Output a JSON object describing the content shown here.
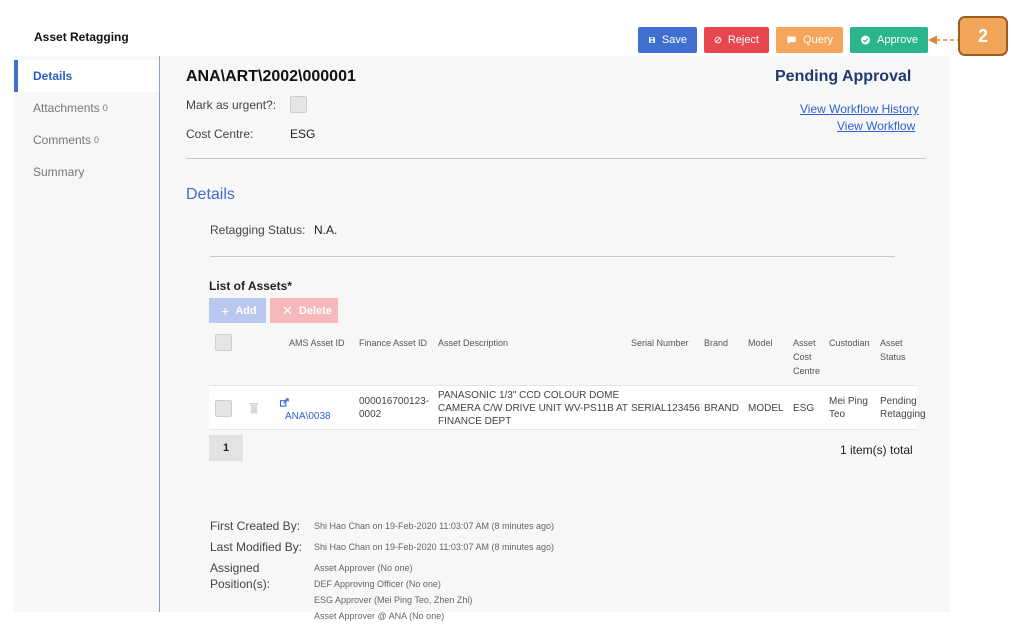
{
  "app": {
    "title": "Asset Retagging"
  },
  "toolbar": {
    "save_label": "Save",
    "reject_label": "Reject",
    "query_label": "Query",
    "approve_label": "Approve"
  },
  "callout": {
    "number": "2"
  },
  "sidebar": {
    "items": [
      {
        "label": "Details",
        "count": ""
      },
      {
        "label": "Attachments",
        "count": "0"
      },
      {
        "label": "Comments",
        "count": "0"
      },
      {
        "label": "Summary",
        "count": ""
      }
    ]
  },
  "header": {
    "doc_number": "ANA\\ART\\2002\\000001",
    "status": "Pending Approval",
    "workflow_history_link": "View Workflow History",
    "workflow_link": "View Workflow"
  },
  "form": {
    "urgent_label": "Mark as urgent?:",
    "cost_centre_label": "Cost Centre:",
    "cost_centre_value": "ESG"
  },
  "details": {
    "title": "Details",
    "retag_status_label": "Retagging Status:",
    "retag_status_value": "N.A."
  },
  "assets": {
    "title": "List of Assets*",
    "add_label": "Add",
    "delete_label": "Delete",
    "columns": {
      "ams_id": "AMS Asset ID",
      "finance_id": "Finance Asset ID",
      "description": "Asset Description",
      "serial": "Serial Number",
      "brand": "Brand",
      "model": "Model",
      "cost_centre_1": "Asset",
      "cost_centre_2": "Cost",
      "cost_centre_3": "Centre",
      "custodian": "Custodian",
      "status_1": "Asset",
      "status_2": "Status"
    },
    "rows": [
      {
        "ams_id": "ANA\\0038",
        "finance_id_1": "000016700123-",
        "finance_id_2": "0002",
        "description_1": "PANASONIC 1/3\" CCD COLOUR DOME",
        "description_2": "CAMERA C/W DRIVE UNIT WV-PS11B AT",
        "description_3": "FINANCE DEPT",
        "serial": "SERIAL123456",
        "brand": "BRAND",
        "model": "MODEL",
        "cost_centre": "ESG",
        "custodian_1": "Mei Ping",
        "custodian_2": "Teo",
        "status_1": "Pending",
        "status_2": "Retagging"
      }
    ],
    "page": "1",
    "total": "1 item(s) total"
  },
  "meta": {
    "first_created_label": "First Created By:",
    "first_created_value": "Shi Hao Chan on 19-Feb-2020 11:03:07 AM (8 minutes ago)",
    "last_modified_label": "Last Modified By:",
    "last_modified_value": "Shi Hao Chan on 19-Feb-2020 11:03:07 AM (8 minutes ago)",
    "assigned_label_1": "Assigned",
    "assigned_label_2": "Position(s):",
    "assigned": [
      "Asset Approver (No one)",
      "DEF Approving Officer (No one)",
      "ESG Approver (Mei Ping Teo, Zhen Zhi)",
      "Asset Approver @ ANA (No one)"
    ]
  },
  "colors": {
    "save": "#3f6fd1",
    "reject": "#e8474f",
    "query": "#f5a65b",
    "approve": "#2bb58a",
    "callout": "#f0a55a"
  }
}
